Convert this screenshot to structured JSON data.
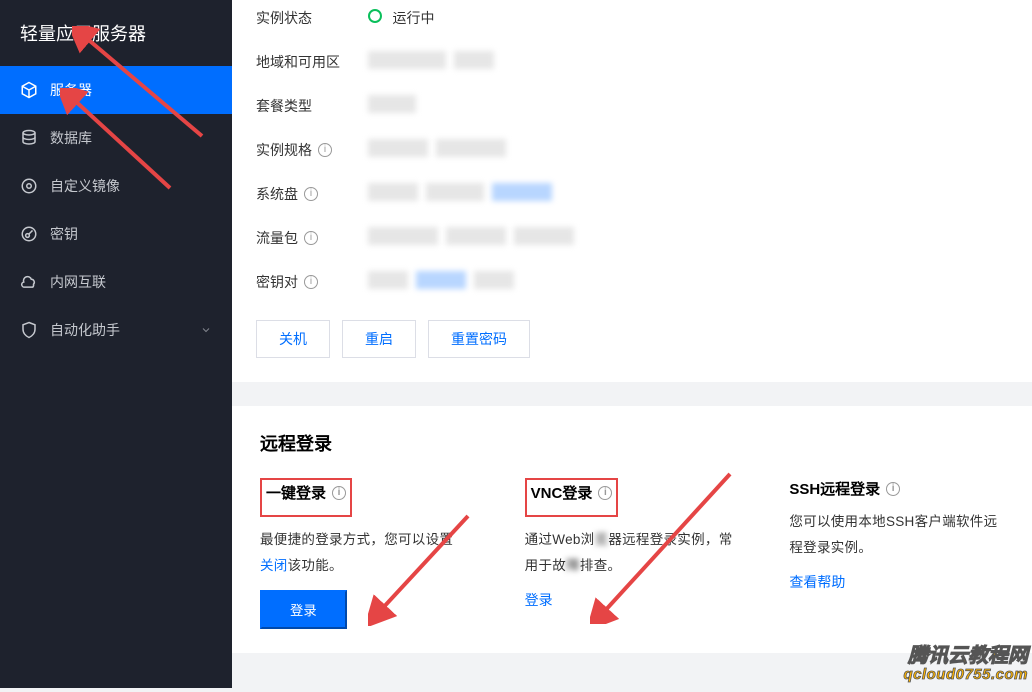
{
  "sidebar": {
    "title": "轻量应用服务器",
    "items": [
      {
        "label": "服务器",
        "icon": "cube",
        "active": true
      },
      {
        "label": "数据库",
        "icon": "database",
        "active": false
      },
      {
        "label": "自定义镜像",
        "icon": "disc",
        "active": false
      },
      {
        "label": "密钥",
        "icon": "key",
        "active": false
      },
      {
        "label": "内网互联",
        "icon": "cloud",
        "active": false
      },
      {
        "label": "自动化助手",
        "icon": "shield",
        "active": false,
        "hasChevron": true
      }
    ]
  },
  "details": {
    "rows": [
      {
        "label": "实例状态",
        "type": "status",
        "value": "运行中"
      },
      {
        "label": "地域和可用区",
        "type": "blur"
      },
      {
        "label": "套餐类型",
        "type": "blur"
      },
      {
        "label": "实例规格",
        "type": "blur",
        "info": true
      },
      {
        "label": "系统盘",
        "type": "blur",
        "info": true
      },
      {
        "label": "流量包",
        "type": "blur",
        "info": true
      },
      {
        "label": "密钥对",
        "type": "blur",
        "info": true
      }
    ],
    "buttons": {
      "shutdown": "关机",
      "restart": "重启",
      "resetPassword": "重置密码"
    }
  },
  "remote": {
    "heading": "远程登录",
    "oneClick": {
      "title": "一键登录",
      "descPrefix": "最便捷的登录方式，您可以设置",
      "closeLink": "关闭",
      "descSuffix": "该功能。",
      "button": "登录"
    },
    "vnc": {
      "title": "VNC登录",
      "descA": "通过Web浏",
      "descB": "器远程登录实例，常用于故",
      "descC": "排查。",
      "link": "登录"
    },
    "ssh": {
      "title": "SSH远程登录",
      "desc": "您可以使用本地SSH客户端软件远程登录实例。",
      "link": "查看帮助"
    }
  },
  "watermark": {
    "line1": "腾讯云教程网",
    "line2": "qcloud0755.com"
  }
}
